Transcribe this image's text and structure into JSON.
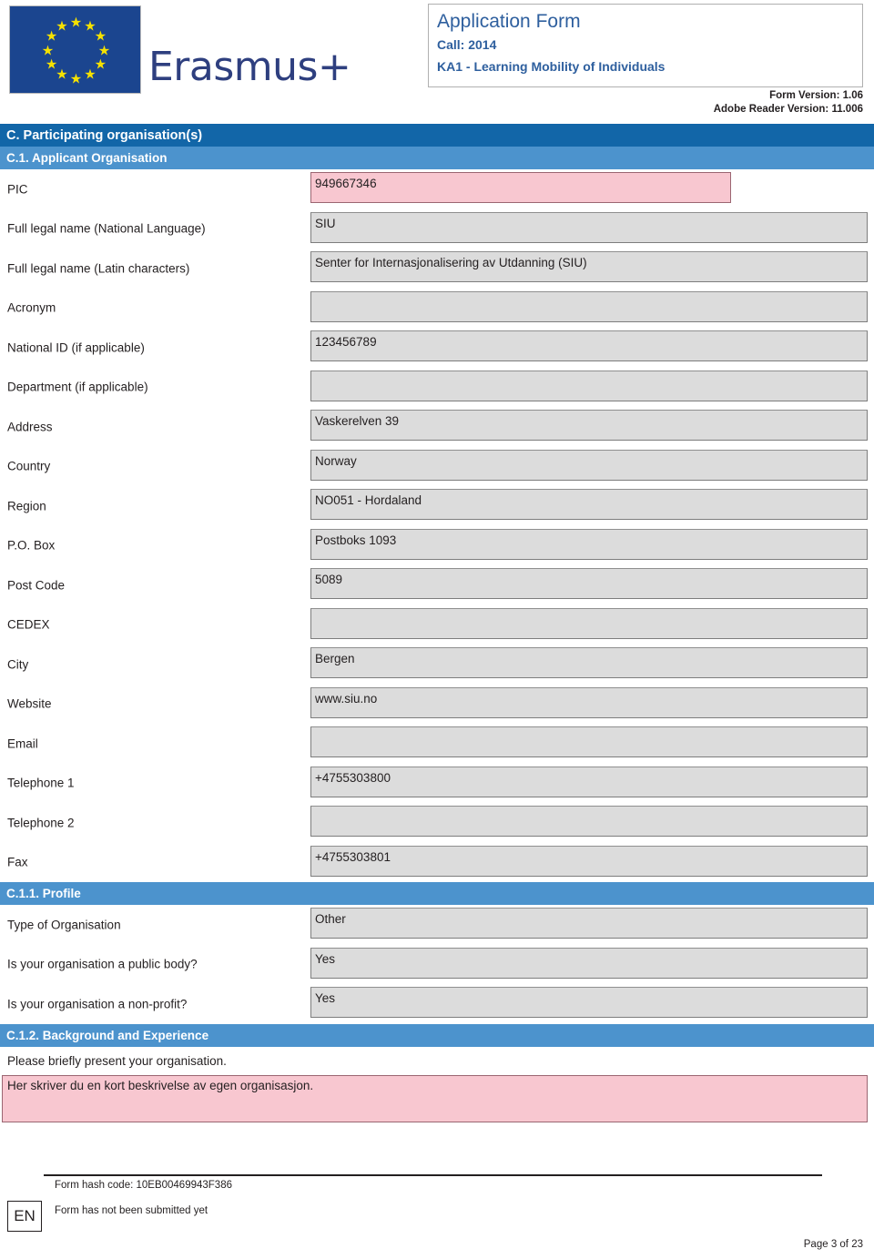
{
  "header": {
    "logo_alt": "European Union flag",
    "wordmark": "Erasmus+",
    "title": "Application Form",
    "call": "Call: 2014",
    "action": "KA1 - Learning Mobility of Individuals",
    "form_version": "Form Version: 1.06",
    "reader_version": "Adobe Reader Version: 11.006"
  },
  "sections": {
    "c": "C. Participating organisation(s)",
    "c1": "C.1. Applicant Organisation",
    "c11": "C.1.1. Profile",
    "c12": "C.1.2. Background and Experience"
  },
  "applicant_fields": [
    {
      "label": "PIC",
      "value": "949667346",
      "style": "pink"
    },
    {
      "label": "Full legal name (National Language)",
      "value": "SIU",
      "style": "grey"
    },
    {
      "label": "Full legal name (Latin characters)",
      "value": "Senter for Internasjonalisering av Utdanning (SIU)",
      "style": "grey"
    },
    {
      "label": "Acronym",
      "value": "",
      "style": "grey"
    },
    {
      "label": "National ID (if applicable)",
      "value": "123456789",
      "style": "grey"
    },
    {
      "label": "Department (if applicable)",
      "value": "",
      "style": "grey"
    },
    {
      "label": "Address",
      "value": "Vaskerelven 39",
      "style": "grey"
    },
    {
      "label": "Country",
      "value": "Norway",
      "style": "grey"
    },
    {
      "label": "Region",
      "value": "NO051 - Hordaland",
      "style": "grey"
    },
    {
      "label": "P.O. Box",
      "value": "Postboks 1093",
      "style": "grey"
    },
    {
      "label": "Post Code",
      "value": "5089",
      "style": "grey"
    },
    {
      "label": "CEDEX",
      "value": "",
      "style": "grey"
    },
    {
      "label": "City",
      "value": "Bergen",
      "style": "grey"
    },
    {
      "label": "Website",
      "value": "www.siu.no",
      "style": "grey"
    },
    {
      "label": "Email",
      "value": "",
      "style": "grey"
    },
    {
      "label": "Telephone 1",
      "value": "+4755303800",
      "style": "grey"
    },
    {
      "label": "Telephone 2",
      "value": "",
      "style": "grey"
    },
    {
      "label": "Fax",
      "value": "+4755303801",
      "style": "grey"
    }
  ],
  "profile_fields": [
    {
      "label": "Type of Organisation",
      "value": "Other"
    },
    {
      "label": "Is your organisation a public body?",
      "value": "Yes"
    },
    {
      "label": "Is your organisation a non-profit?",
      "value": "Yes"
    }
  ],
  "background": {
    "prompt": "Please briefly present your organisation.",
    "answer": "Her skriver du en kort beskrivelse av egen organisasjon."
  },
  "footer": {
    "hash": "Form hash code: 10EB00469943F386",
    "language": "EN",
    "status": "Form has not been submitted yet",
    "page": "Page 3 of 23"
  },
  "colors": {
    "section_primary": "#1266a8",
    "section_secondary": "#4c93cd",
    "field_grey": "#dcdcdc",
    "field_pink": "#f8c7d0",
    "eu_blue": "#1b458f",
    "eu_yellow": "#f5e100",
    "title_blue": "#2e5f9e"
  }
}
